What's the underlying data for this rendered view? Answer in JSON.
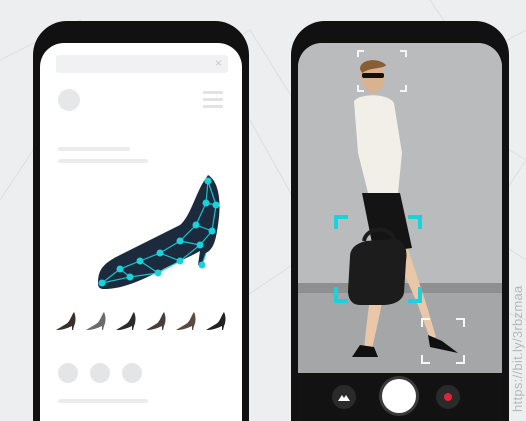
{
  "search_bar": {
    "close_icon": "×"
  },
  "icons": {
    "close": "close-icon",
    "menu": "hamburger-menu-icon",
    "camera_mode": "mountain-icon",
    "shutter": "shutter-button",
    "record": "record-icon"
  },
  "colors": {
    "accent": "#19d3dc",
    "shoe_navy": "#1c2a3d",
    "record_red": "#e0243a"
  },
  "detections": [
    "head",
    "handbag",
    "shoe"
  ],
  "shoe_variants": 6,
  "watermark": "https://bit.ly/3rbzmaa"
}
